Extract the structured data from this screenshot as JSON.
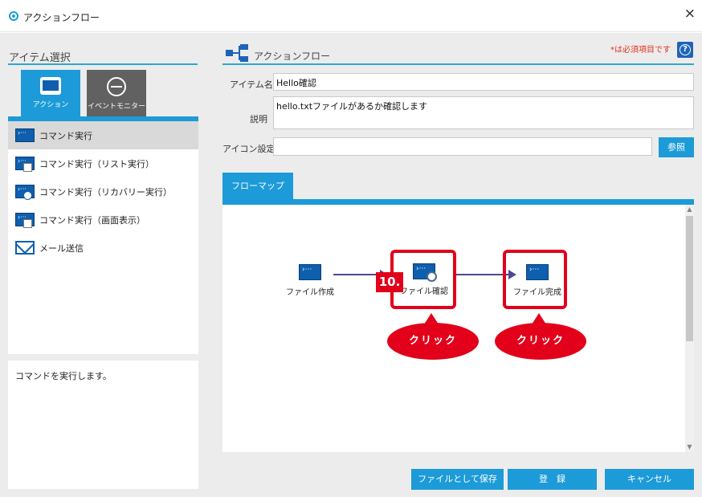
{
  "window": {
    "title": "アクションフロー",
    "close_glyph": "×"
  },
  "left": {
    "title": "アイテム選択",
    "tabs": [
      {
        "label": "アクション",
        "icon": "command-icon",
        "active": true
      },
      {
        "label": "イベントモニター",
        "icon": "event-monitor-icon",
        "active": false
      }
    ],
    "items": [
      {
        "label": "コマンド実行",
        "icon": "command-icon",
        "selected": true
      },
      {
        "label": "コマンド実行（リスト実行）",
        "icon": "command-list-icon",
        "selected": false
      },
      {
        "label": "コマンド実行（リカバリー実行）",
        "icon": "command-recovery-icon",
        "selected": false
      },
      {
        "label": "コマンド実行（画面表示）",
        "icon": "command-screen-icon",
        "selected": false
      },
      {
        "label": "メール送信",
        "icon": "mail-icon",
        "selected": false
      }
    ],
    "description": "コマンドを実行します。"
  },
  "right": {
    "title": "アクションフロー",
    "required_note": "*は必須項目です",
    "help_glyph": "?",
    "form": {
      "item_name_label": "アイテム名",
      "required_mark": "*",
      "item_name_value": "Hello確認",
      "description_label": "説明",
      "description_value": "hello.txtファイルがあるか確認します",
      "icon_label": "アイコン設定",
      "icon_value": "",
      "browse_label": "参照"
    },
    "flowmap": {
      "tab_label": "フローマップ",
      "nodes": [
        {
          "label": "ファイル作成"
        },
        {
          "label": "ファイル確認"
        },
        {
          "label": "ファイル完成"
        }
      ]
    },
    "annotations": {
      "step": "10.",
      "click_1": "クリック",
      "click_2": "クリック",
      "color": "#e2001a"
    },
    "buttons": {
      "save_as_file": "ファイルとして保存",
      "register": "登　録",
      "cancel": "キャンセル"
    }
  },
  "colors": {
    "accent": "#1c9bd8",
    "tab_inactive": "#616161",
    "command_icon": "#0e5fae"
  }
}
